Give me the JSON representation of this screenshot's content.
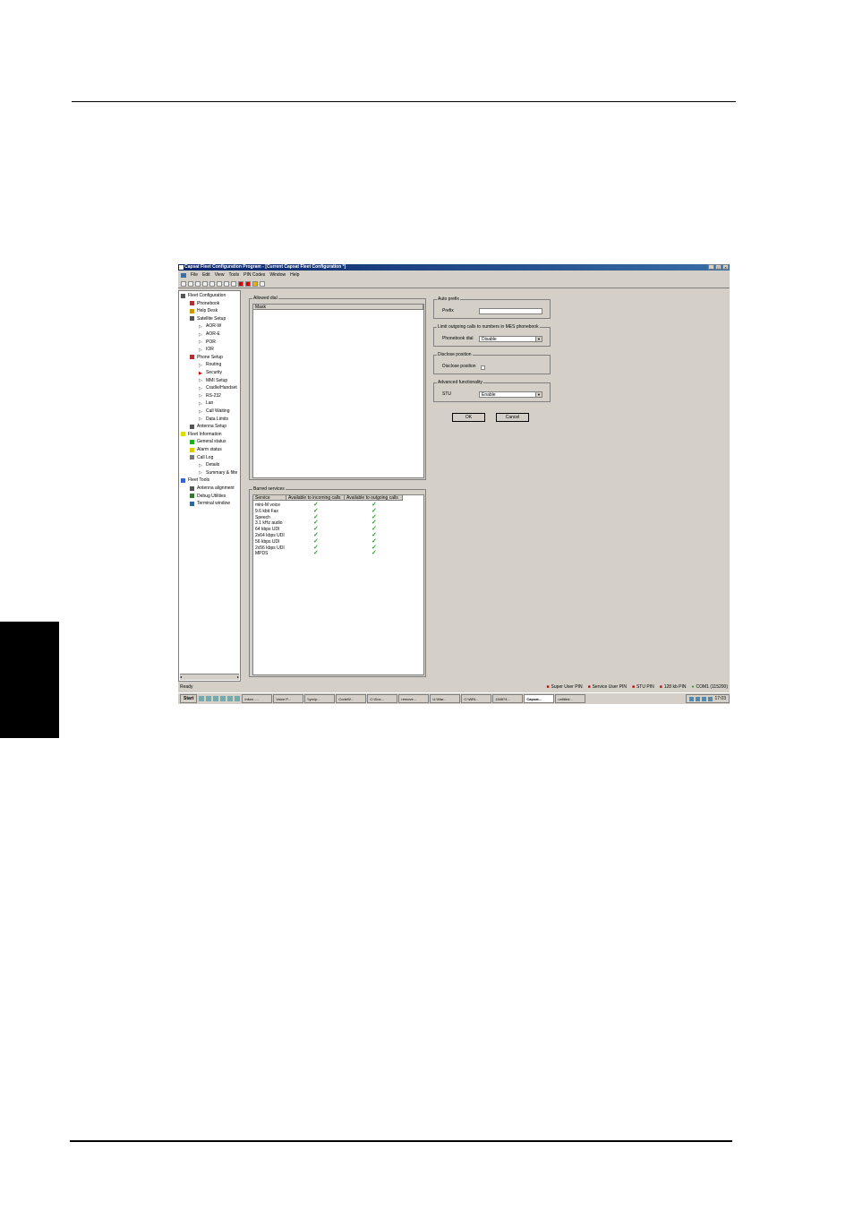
{
  "app": {
    "title": "Capsat Fleet Configuration Program - [Current Capsat Fleet Configuration *]",
    "window_buttons": [
      "_",
      "□",
      "×"
    ],
    "menu": [
      "File",
      "Edit",
      "View",
      "Tools",
      "PIN Codes",
      "Window",
      "Help"
    ]
  },
  "tree": [
    {
      "label": "Fleet Configuration",
      "icon": "computer-icon",
      "level": 0
    },
    {
      "label": "Phonebook",
      "icon": "phonebook-icon",
      "level": 1
    },
    {
      "label": "Help Desk",
      "icon": "helpdesk-icon",
      "level": 1
    },
    {
      "label": "Satellite Setup",
      "icon": "satellite-icon",
      "level": 1
    },
    {
      "label": "AOR-W",
      "icon": "arrow-icon",
      "level": 2
    },
    {
      "label": "AOR-E",
      "icon": "arrow-icon",
      "level": 2
    },
    {
      "label": "POR",
      "icon": "arrow-icon",
      "level": 2
    },
    {
      "label": "IOR",
      "icon": "arrow-icon",
      "level": 2
    },
    {
      "label": "Phone Setup",
      "icon": "phone-icon",
      "level": 1
    },
    {
      "label": "Routing",
      "icon": "arrow-icon",
      "level": 2
    },
    {
      "label": "Security",
      "icon": "selected-arrow-icon",
      "level": 2
    },
    {
      "label": "MMI Setup",
      "icon": "arrow-icon",
      "level": 2
    },
    {
      "label": "Cradle/Handset",
      "icon": "arrow-icon",
      "level": 2
    },
    {
      "label": "RS-232",
      "icon": "arrow-icon",
      "level": 2
    },
    {
      "label": "Lan",
      "icon": "arrow-icon",
      "level": 2
    },
    {
      "label": "Call Waiting",
      "icon": "arrow-icon",
      "level": 2
    },
    {
      "label": "Data Limits",
      "icon": "arrow-icon",
      "level": 2
    },
    {
      "label": "Antenna Setup",
      "icon": "antenna-icon",
      "level": 1
    },
    {
      "label": "Fleet Information",
      "icon": "lightbulb-icon",
      "level": 0
    },
    {
      "label": "General status",
      "icon": "status-icon",
      "level": 1
    },
    {
      "label": "Alarm status",
      "icon": "alarm-icon",
      "level": 1
    },
    {
      "label": "Call Log",
      "icon": "calllog-icon",
      "level": 1
    },
    {
      "label": "Details",
      "icon": "arrow-icon",
      "level": 2
    },
    {
      "label": "Summary & filte",
      "icon": "arrow-icon",
      "level": 2
    },
    {
      "label": "Fleet Tools",
      "icon": "wrench-icon",
      "level": 0
    },
    {
      "label": "Antenna alignment",
      "icon": "antenna-icon",
      "level": 1
    },
    {
      "label": "Debug Utilities",
      "icon": "debug-icon",
      "level": 1
    },
    {
      "label": "Terminal window",
      "icon": "terminal-icon",
      "level": 1
    }
  ],
  "allowed_dial": {
    "title": "Allowed dial",
    "column": "Mask"
  },
  "barred_services": {
    "title": "Barred services",
    "columns": [
      "Service",
      "Available to incoming calls",
      "Available to outgoing calls"
    ],
    "rows": [
      {
        "service": "mini-M voice",
        "incoming": true,
        "outgoing": true
      },
      {
        "service": "9.6 kbit Fax",
        "incoming": true,
        "outgoing": true
      },
      {
        "service": "Speech",
        "incoming": true,
        "outgoing": true
      },
      {
        "service": "3.1 kHz audio",
        "incoming": true,
        "outgoing": true
      },
      {
        "service": "64 kbps UDI",
        "incoming": true,
        "outgoing": true
      },
      {
        "service": "2x64 kbps UDI",
        "incoming": true,
        "outgoing": true
      },
      {
        "service": "56 kbps UDI",
        "incoming": true,
        "outgoing": true
      },
      {
        "service": "2x56 kbps UDI",
        "incoming": true,
        "outgoing": true
      },
      {
        "service": "MPDS",
        "incoming": true,
        "outgoing": true
      }
    ],
    "check_glyph": "✓"
  },
  "auto_prefix": {
    "title": "Auto prefix",
    "label": "Prefix",
    "value": ""
  },
  "limit_outgoing": {
    "title": "Limit outgoing calls to numbers in MES phonebook",
    "label": "Phonebook dial",
    "value": "Disable"
  },
  "disclose_position": {
    "title": "Disclose position",
    "label": "Disclose position",
    "checked": false
  },
  "advanced": {
    "title": "Advanced functionality",
    "label": "STU",
    "value": "Enable"
  },
  "buttons": {
    "ok": "OK",
    "cancel": "Cancel"
  },
  "status": {
    "ready": "Ready",
    "pins": [
      "Super User PIN",
      "Service User PIN",
      "STU PIN",
      "128 kb PIN"
    ],
    "port": "COM1 (115200)"
  },
  "taskbar": {
    "start": "Start",
    "tasks": [
      "Inbox -...",
      "Voice P...",
      "\\\\yrc\\p...",
      "CodeW...",
      "C:\\Doc...",
      "remove...",
      "U:\\Mar...",
      "C:\\WIN...",
      "116874...",
      "Capsat...",
      "untitled..."
    ],
    "active": "Capsat...",
    "clock": "17:03"
  },
  "colors": {
    "check": "#2a9d2a",
    "titlebar": "#0a246a",
    "face": "#d4d0c8"
  }
}
